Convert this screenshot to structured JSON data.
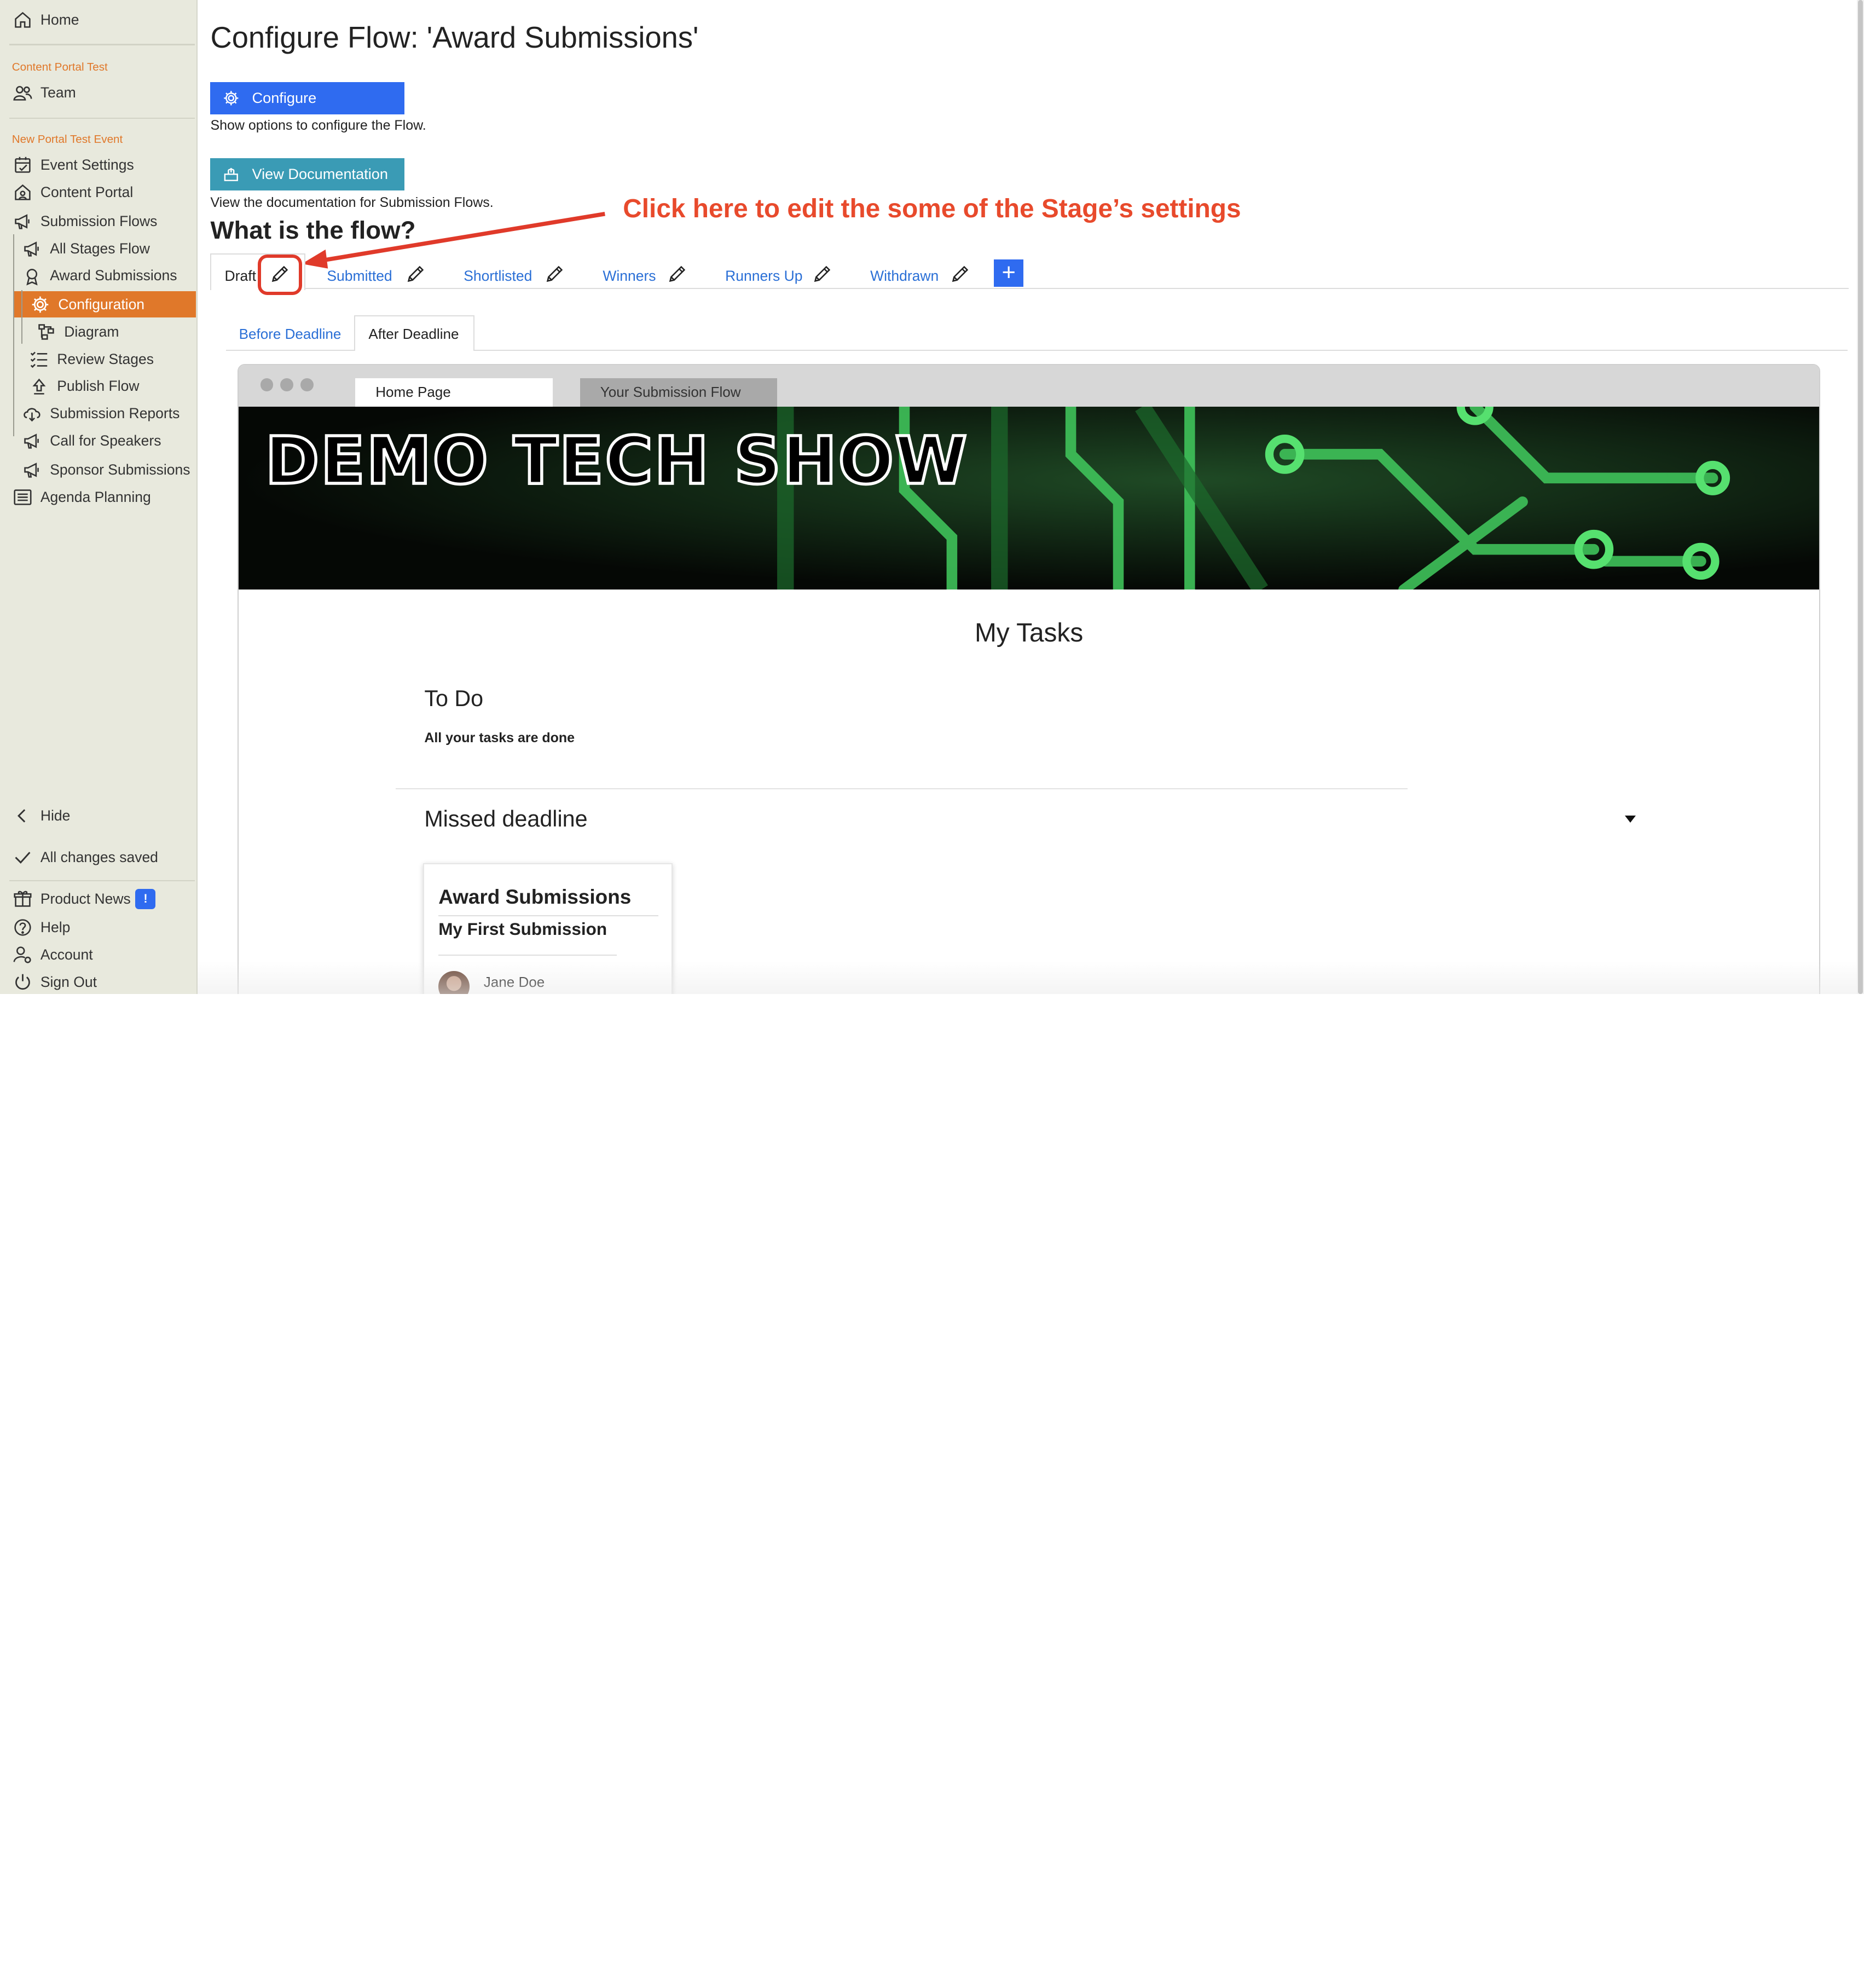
{
  "sidebar": {
    "home": "Home",
    "section1": "Content Portal Test",
    "team": "Team",
    "section2": "New Portal Test Event",
    "event_settings": "Event Settings",
    "content_portal": "Content Portal",
    "submission_flows": "Submission Flows",
    "all_stages_flow": "All Stages Flow",
    "award_submissions": "Award Submissions",
    "configuration": "Configuration",
    "diagram": "Diagram",
    "review_stages": "Review Stages",
    "publish_flow": "Publish Flow",
    "submission_reports": "Submission Reports",
    "call_for_speakers": "Call for Speakers",
    "sponsor_submissions": "Sponsor Submissions",
    "agenda_planning": "Agenda Planning",
    "hide": "Hide",
    "all_changes_saved": "All changes saved",
    "product_news": "Product News",
    "product_news_badge": "!",
    "help": "Help",
    "account": "Account",
    "sign_out": "Sign Out"
  },
  "main": {
    "title": "Configure Flow: 'Award Submissions'",
    "configure_label": "Configure",
    "configure_help": "Show options to configure the Flow.",
    "docs_label": "View Documentation",
    "docs_help": "View the documentation for Submission Flows.",
    "flow_heading": "What is the flow?",
    "annotation": "Click here to edit the some of the Stage’s settings",
    "stages": [
      "Draft",
      "Submitted",
      "Shortlisted",
      "Winners",
      "Runners Up",
      "Withdrawn"
    ],
    "add_stage": "+",
    "subtabs": [
      "Before Deadline",
      "After Deadline"
    ]
  },
  "preview": {
    "tabs": [
      "Home Page",
      "Your Submission Flow"
    ],
    "banner_title": "DEMO TECH SHOW",
    "my_tasks": "My Tasks",
    "todo_heading": "To Do",
    "todo_text": "All your tasks are done",
    "missed_heading": "Missed deadline",
    "card_title": "Award Submissions",
    "card_subtitle": "My First Submission",
    "card_author": "Jane Doe"
  },
  "colors": {
    "accent_orange": "#e0782a",
    "primary_blue": "#2f6bf0",
    "docs_teal": "#3a9bb5",
    "annotation_red": "#e84a2c",
    "sidebar_bg": "#e8e9dd"
  }
}
